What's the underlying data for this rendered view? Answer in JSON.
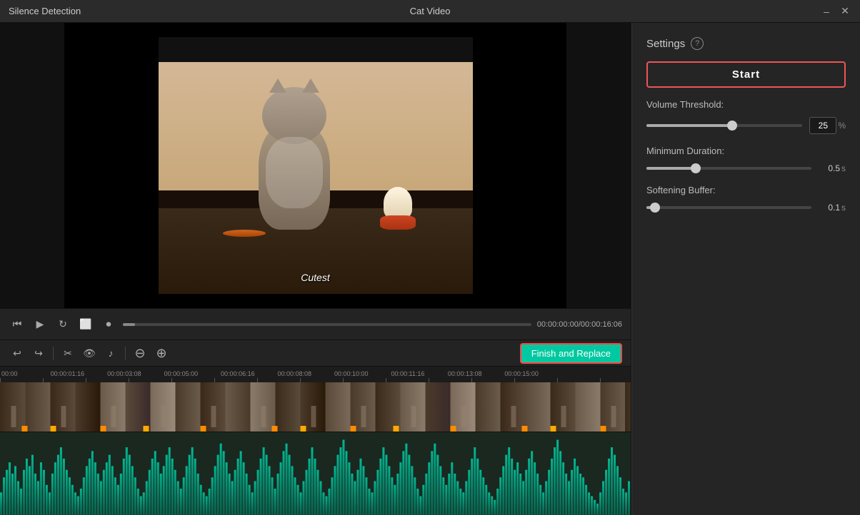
{
  "window": {
    "title_left": "Silence Detection",
    "title_center": "Cat Video",
    "minimize_label": "–",
    "close_label": "✕"
  },
  "video": {
    "subtitle": "Cutest",
    "timestamp": "00:00:00:00/00:00:16:06"
  },
  "timeline": {
    "ruler_labels": [
      "00:00",
      "00:00:01:16",
      "00:00:03:08",
      "00:00:05:00",
      "00:00:06:16",
      "00:00:08:08",
      "00:00:10:00",
      "00:00:11:16",
      "00:00:13:08",
      "00:00:15:00"
    ],
    "finish_replace_label": "Finish and Replace"
  },
  "settings": {
    "title": "Settings",
    "help_icon_label": "?",
    "start_button_label": "Start",
    "volume_threshold": {
      "label": "Volume Threshold:",
      "value": 25,
      "unit": "%",
      "slider_pct": 55
    },
    "minimum_duration": {
      "label": "Minimum Duration:",
      "value": "0.5",
      "unit": "s",
      "slider_pct": 30
    },
    "softening_buffer": {
      "label": "Softening Buffer:",
      "value": "0.1",
      "unit": "s",
      "slider_pct": 5
    }
  },
  "playback": {
    "time_display": "00:00:00:00/00:00:16:06"
  },
  "toolbar": {
    "undo_label": "↩",
    "redo_label": "↪",
    "cut_label": "✂",
    "eye_label": "👁",
    "audio_label": "♪"
  }
}
